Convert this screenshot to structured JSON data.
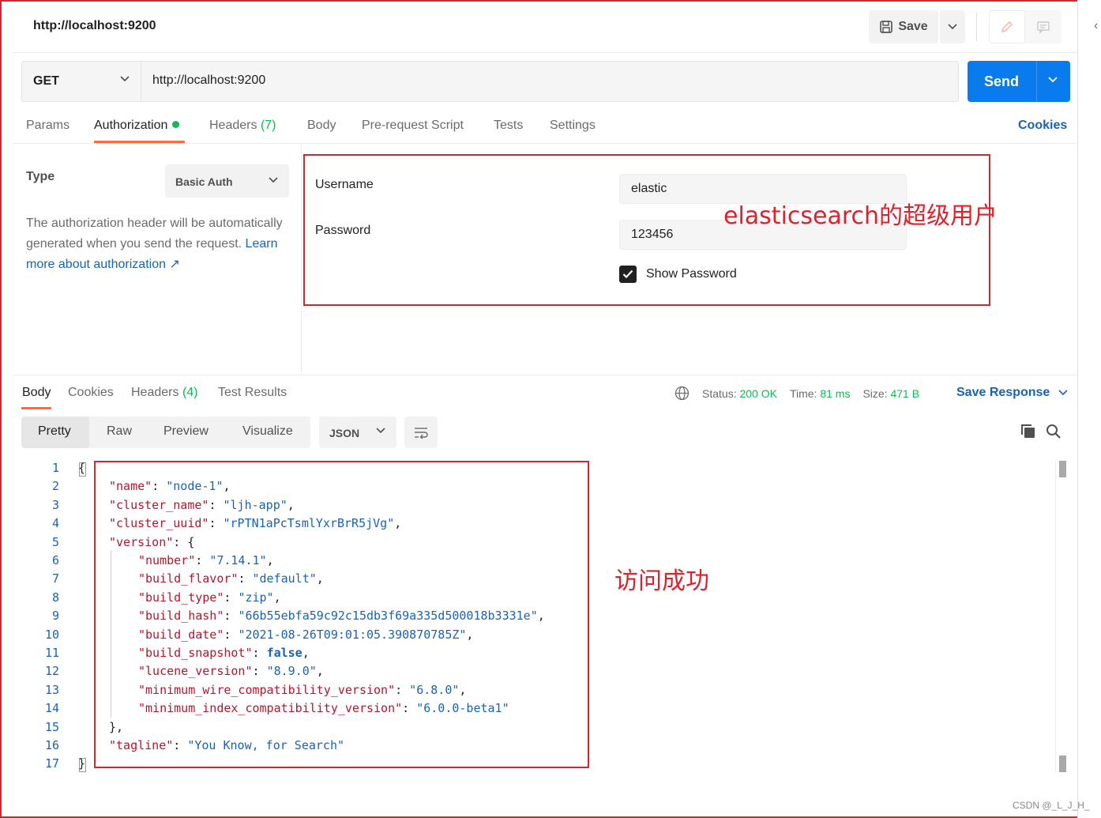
{
  "request": {
    "title": "http://localhost:9200",
    "save_label": "Save",
    "method": "GET",
    "url": "http://localhost:9200",
    "send_label": "Send"
  },
  "request_tabs": [
    {
      "label": "Params"
    },
    {
      "label": "Authorization"
    },
    {
      "label": "Headers",
      "count": "(7)"
    },
    {
      "label": "Body"
    },
    {
      "label": "Pre-request Script"
    },
    {
      "label": "Tests"
    },
    {
      "label": "Settings"
    }
  ],
  "cookies_label": "Cookies",
  "auth": {
    "type_label": "Type",
    "type_value": "Basic Auth",
    "description": "The authorization header will be automatically generated when you send the request.",
    "learn_more": "Learn more about authorization ↗",
    "username_label": "Username",
    "username_value": "elastic",
    "password_label": "Password",
    "password_value": "123456",
    "show_password_label": "Show Password",
    "show_password_checked": true
  },
  "annotations": {
    "auth_note": "elasticsearch的超级用户",
    "response_note": "访问成功"
  },
  "response_tabs": [
    {
      "label": "Body"
    },
    {
      "label": "Cookies"
    },
    {
      "label": "Headers",
      "count": "(4)"
    },
    {
      "label": "Test Results"
    }
  ],
  "response_status": {
    "status_label": "Status:",
    "status_value": "200 OK",
    "time_label": "Time:",
    "time_value": "81 ms",
    "size_label": "Size:",
    "size_value": "471 B",
    "save_response_label": "Save Response"
  },
  "view_modes": [
    "Pretty",
    "Raw",
    "Preview",
    "Visualize"
  ],
  "format": "JSON",
  "response_lines": [
    {
      "n": "1",
      "t": "{"
    },
    {
      "n": "2",
      "k": "\"name\"",
      "v": "\"node-1\"",
      "e": ","
    },
    {
      "n": "3",
      "k": "\"cluster_name\"",
      "v": "\"ljh-app\"",
      "e": ","
    },
    {
      "n": "4",
      "k": "\"cluster_uuid\"",
      "v": "\"rPTN1aPcTsmlYxrBrR5jVg\"",
      "e": ","
    },
    {
      "n": "5",
      "k": "\"version\"",
      "v": "{",
      "e": ""
    },
    {
      "n": "6",
      "k": "\"number\"",
      "v": "\"7.14.1\"",
      "e": ","
    },
    {
      "n": "7",
      "k": "\"build_flavor\"",
      "v": "\"default\"",
      "e": ","
    },
    {
      "n": "8",
      "k": "\"build_type\"",
      "v": "\"zip\"",
      "e": ","
    },
    {
      "n": "9",
      "k": "\"build_hash\"",
      "v": "\"66b55ebfa59c92c15db3f69a335d500018b3331e\"",
      "e": ","
    },
    {
      "n": "10",
      "k": "\"build_date\"",
      "v": "\"2021-08-26T09:01:05.390870785Z\"",
      "e": ","
    },
    {
      "n": "11",
      "k": "\"build_snapshot\"",
      "v": "false",
      "e": ","
    },
    {
      "n": "12",
      "k": "\"lucene_version\"",
      "v": "\"8.9.0\"",
      "e": ","
    },
    {
      "n": "13",
      "k": "\"minimum_wire_compatibility_version\"",
      "v": "\"6.8.0\"",
      "e": ","
    },
    {
      "n": "14",
      "k": "\"minimum_index_compatibility_version\"",
      "v": "\"6.0.0-beta1\"",
      "e": ""
    },
    {
      "n": "15",
      "t": "},"
    },
    {
      "n": "16",
      "k": "\"tagline\"",
      "v": "\"You Know, for Search\"",
      "e": ""
    },
    {
      "n": "17",
      "t": "}"
    }
  ],
  "watermark": "CSDN @_L_J_H_"
}
